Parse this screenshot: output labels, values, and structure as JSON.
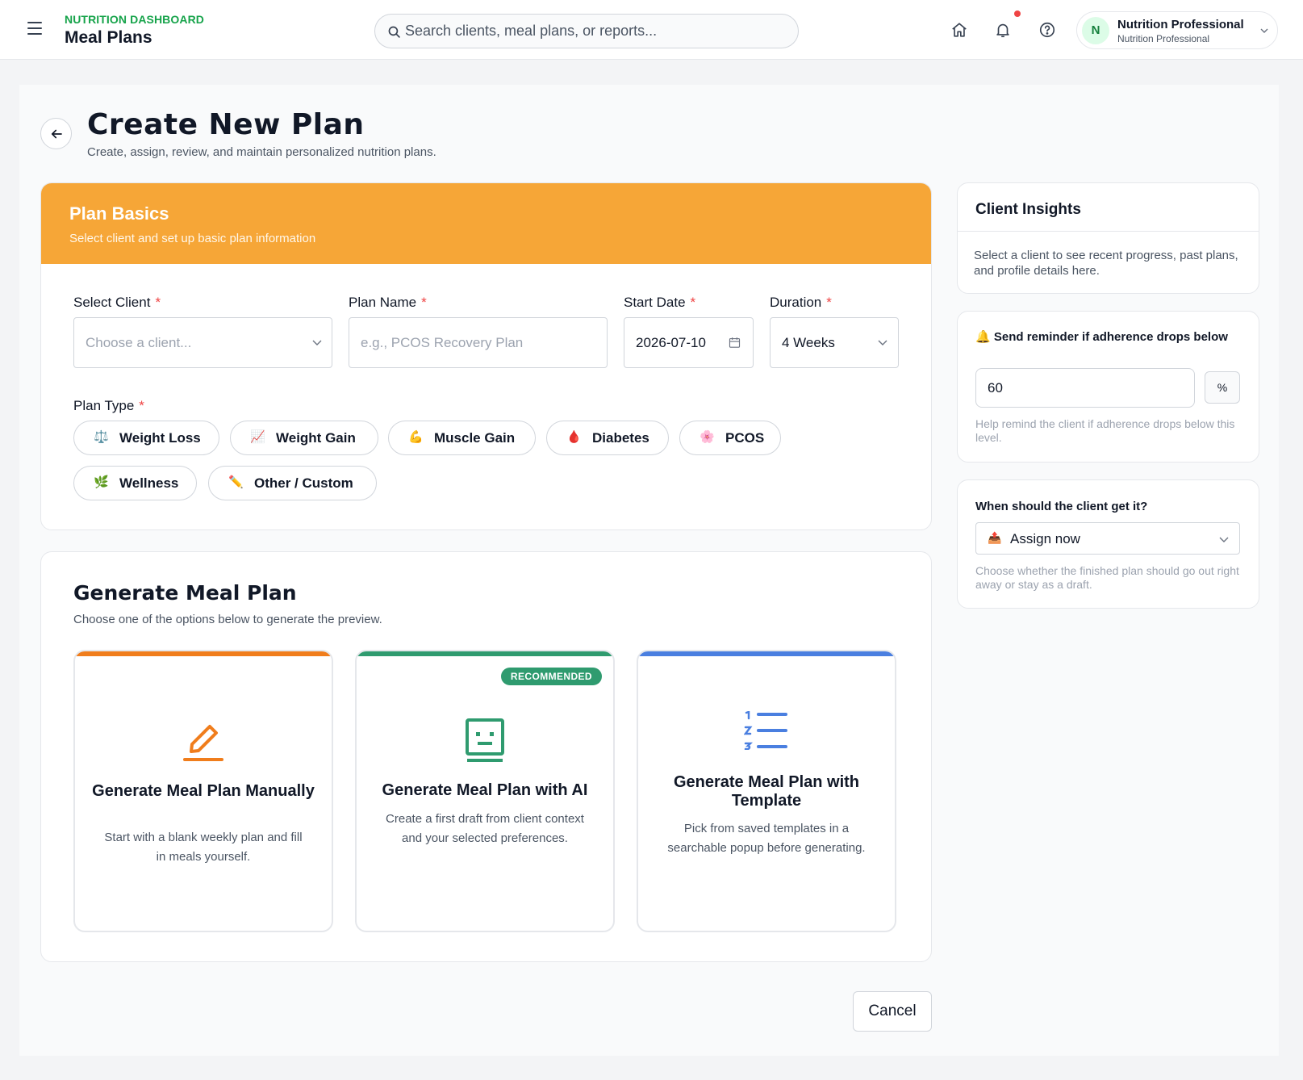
{
  "header": {
    "kicker": "NUTRITION DASHBOARD",
    "title": "Meal Plans",
    "search_placeholder": "Search clients, meal plans, or reports...",
    "icons": [
      "menu-icon",
      "search-icon",
      "home-icon",
      "bell-icon",
      "help-icon",
      "chevron-down-icon"
    ],
    "user": {
      "initial": "N",
      "name": "Nutrition Professional",
      "role": "Nutrition Professional"
    }
  },
  "page": {
    "title": "Create New Plan",
    "subtitle": "Create, assign, review, and maintain personalized nutrition plans."
  },
  "plan_basics": {
    "title": "Plan Basics",
    "subtitle": "Select client and set up basic plan information",
    "header_color": "#f6a637",
    "client": {
      "label": "Select Client",
      "required_mark": "*",
      "placeholder": "Choose a client..."
    },
    "plan_name": {
      "label": "Plan Name",
      "required_mark": "*",
      "placeholder": "e.g., PCOS Recovery Plan"
    },
    "start_date": {
      "label": "Start Date",
      "required_mark": "*",
      "value": "2026-07-10"
    },
    "duration": {
      "label": "Duration",
      "required_mark": "*",
      "value": "4 Weeks"
    },
    "plan_type": {
      "label": "Plan Type",
      "required_mark": "*",
      "options": [
        {
          "emoji": "⚖️",
          "label": "Weight Loss"
        },
        {
          "emoji": "📈",
          "label": "Weight Gain"
        },
        {
          "emoji": "💪",
          "label": "Muscle Gain"
        },
        {
          "emoji": "🩸",
          "label": "Diabetes"
        },
        {
          "emoji": "🌸",
          "label": "PCOS"
        },
        {
          "emoji": "🌿",
          "label": "Wellness"
        },
        {
          "emoji": "✏️",
          "label": "Other / Custom"
        }
      ]
    }
  },
  "generate": {
    "title": "Generate Meal Plan",
    "subtitle": "Choose one of the options below to generate the preview.",
    "options": [
      {
        "title": "Generate Meal Plan Manually",
        "description": "Start with a blank weekly plan and fill in meals yourself.",
        "accent": "#f07d1c",
        "icon": "pencil-icon"
      },
      {
        "title": "Generate Meal Plan with AI",
        "description": "Create a first draft from client context and your selected preferences.",
        "accent": "#2f9b6f",
        "icon": "robot-icon",
        "badge": "RECOMMENDED"
      },
      {
        "title": "Generate Meal Plan with Template",
        "description": "Pick from saved templates in a searchable popup before generating.",
        "accent": "#4a7fe0",
        "icon": "numbered-list-icon"
      }
    ]
  },
  "actions": {
    "cancel": "Cancel"
  },
  "insights": {
    "title": "Client Insights",
    "text": "Select a client to see recent progress, past plans, and profile details here."
  },
  "reminder": {
    "emoji": "🔔",
    "label": "Send reminder if adherence drops below",
    "value": "60",
    "unit": "%",
    "help": "Help remind the client if adherence drops below this level."
  },
  "delivery": {
    "label": "When should the client get it?",
    "emoji": "📤",
    "value": "Assign now",
    "help": "Choose whether the finished plan should go out right away or stay as a draft."
  }
}
